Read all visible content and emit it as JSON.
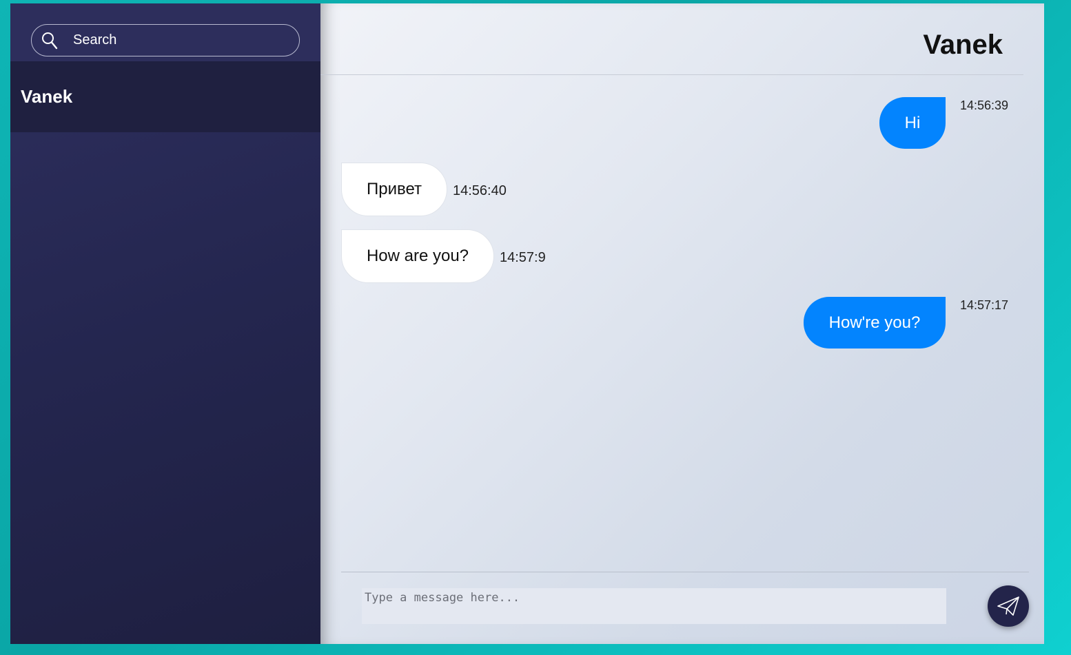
{
  "sidebar": {
    "search": {
      "placeholder": "Search",
      "icon": "search-icon"
    },
    "contacts": [
      {
        "name": "Vanek",
        "active": true
      }
    ]
  },
  "chat": {
    "title": "Vanek",
    "messages": [
      {
        "direction": "outgoing",
        "text": "Hi",
        "time": "14:56:39"
      },
      {
        "direction": "incoming",
        "text": "Привет",
        "time": "14:56:40"
      },
      {
        "direction": "incoming",
        "text": "How are you?",
        "time": "14:57:9"
      },
      {
        "direction": "outgoing",
        "text": "How're you?",
        "time": "14:57:17"
      }
    ]
  },
  "composer": {
    "placeholder": "Type a message here...",
    "send_icon": "paper-plane-icon"
  },
  "colors": {
    "outgoing_bubble": "#0384fe",
    "sidebar_bg": "#24264f",
    "background": "#0aa6a6"
  }
}
